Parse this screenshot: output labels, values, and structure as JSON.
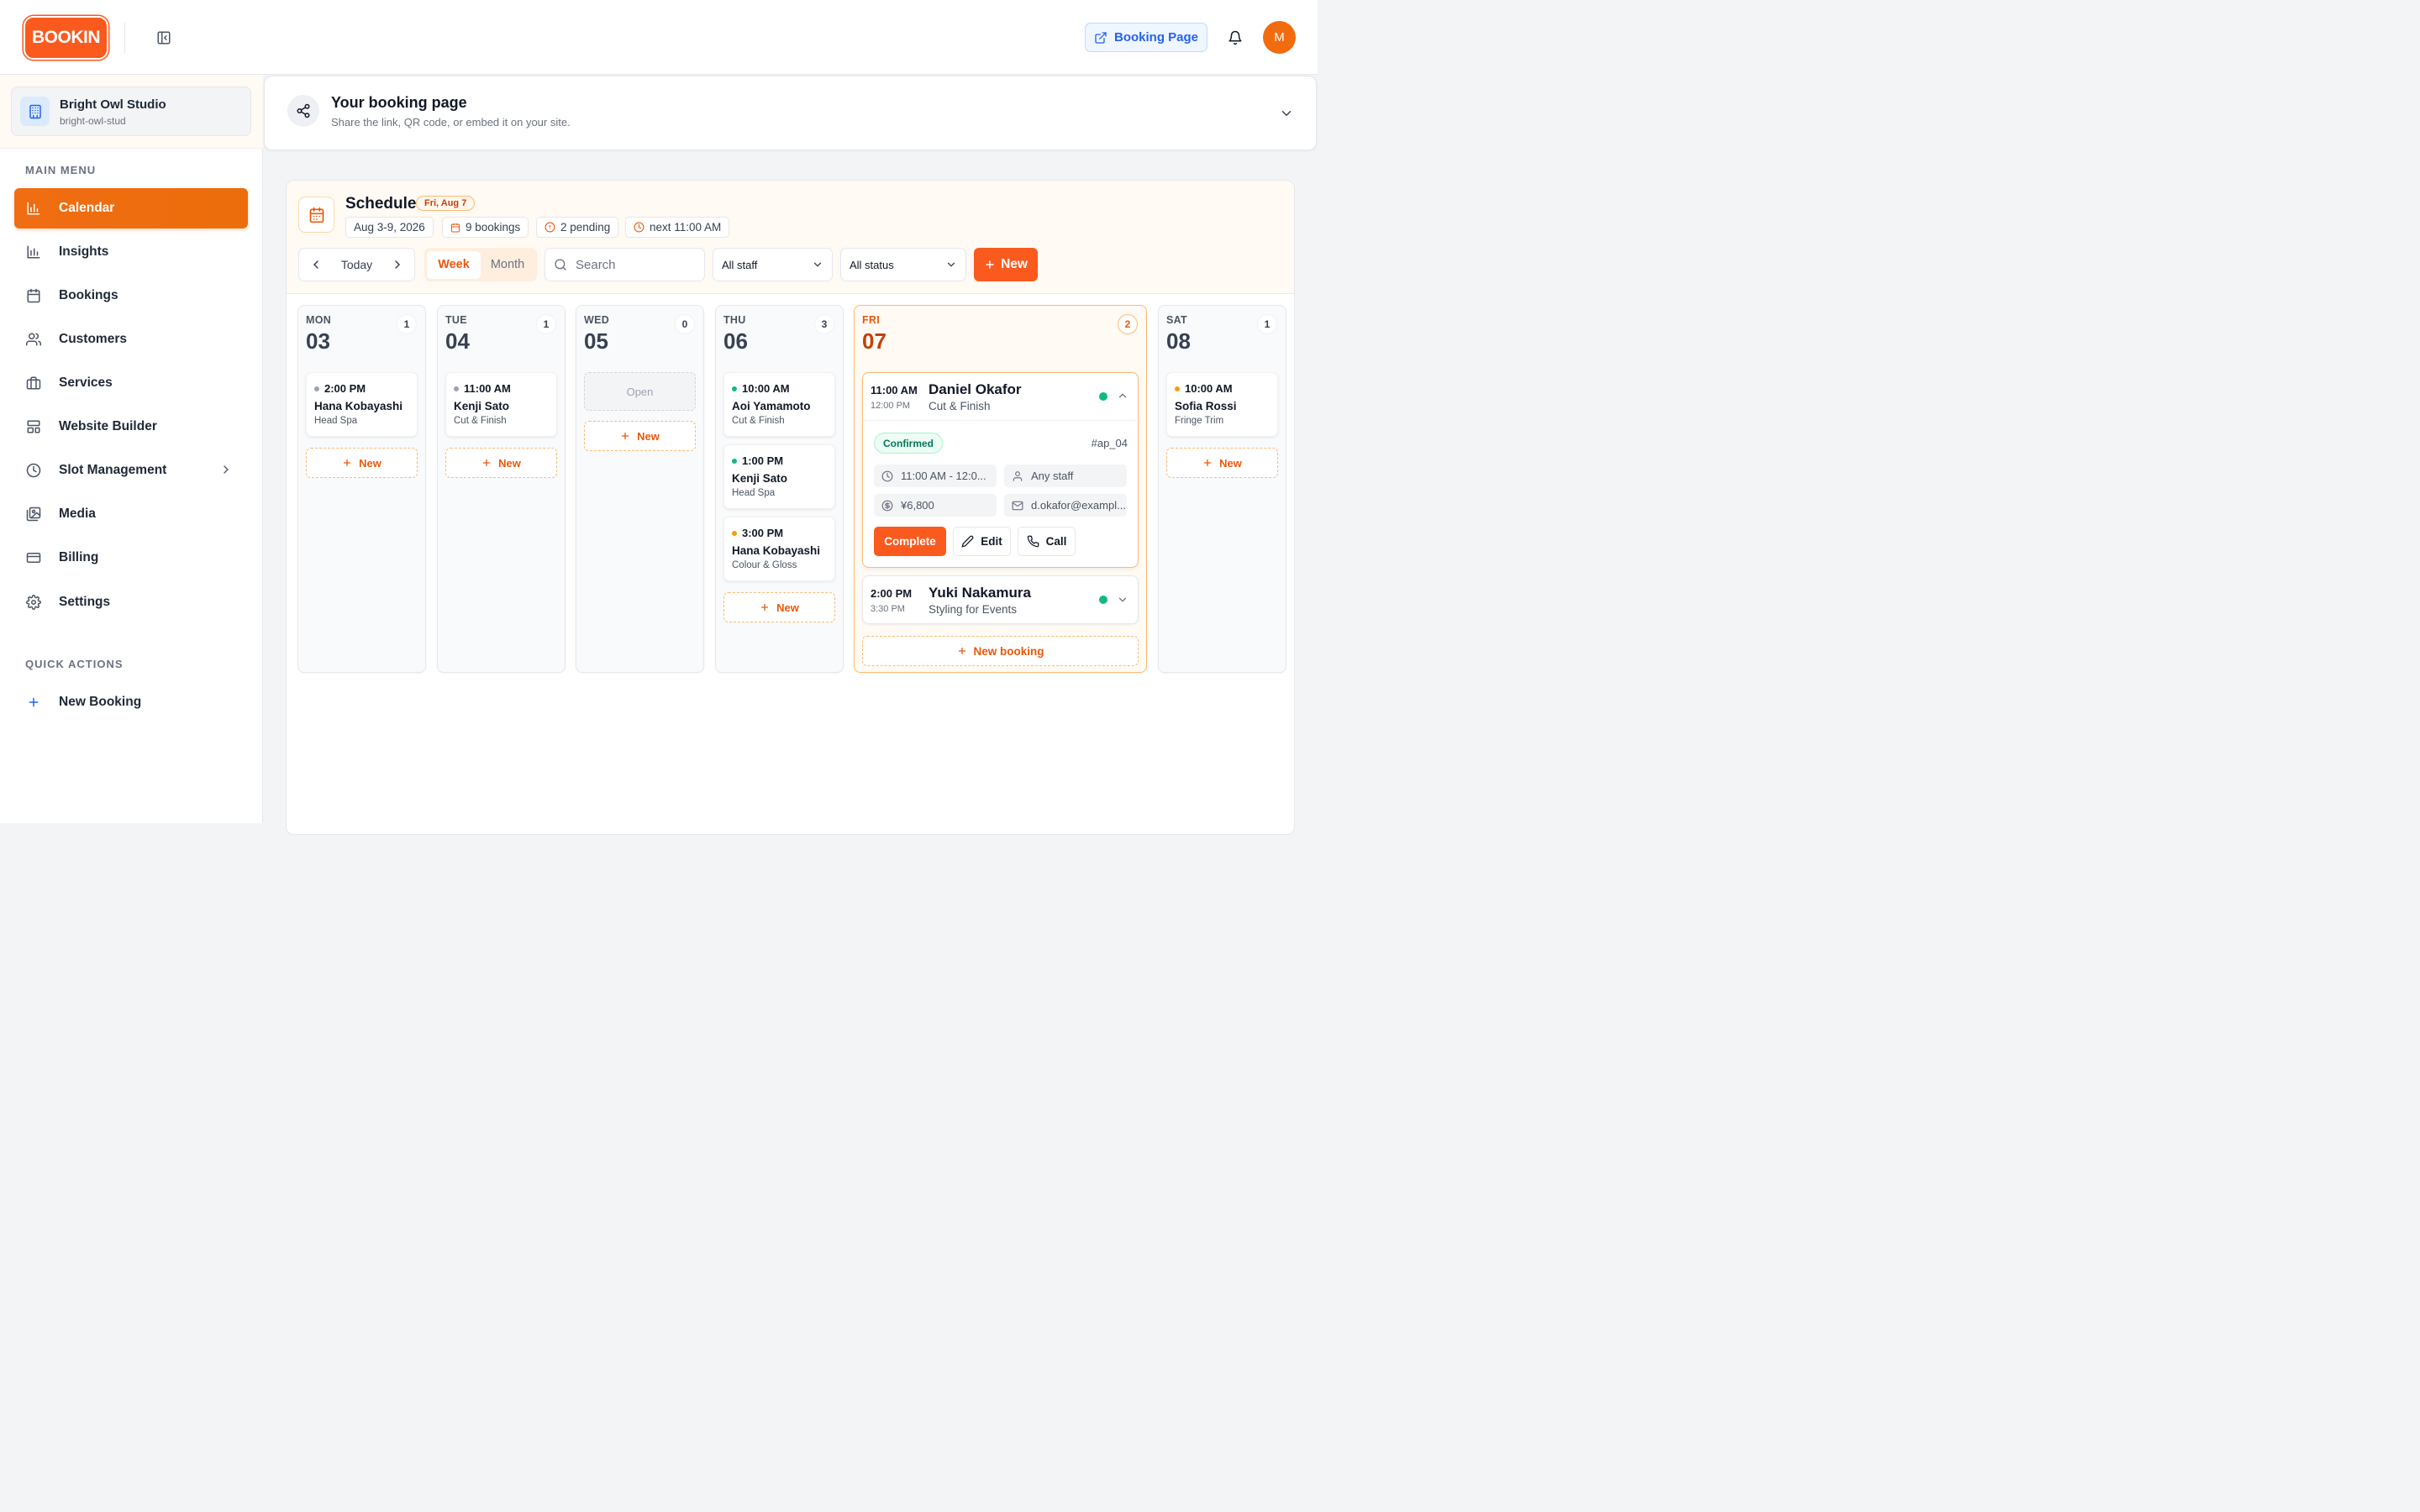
{
  "app": {
    "logo_text": "BOOKIN",
    "booking_page_label": "Booking Page",
    "avatar_initial": "M",
    "accent_color": "#fa5a1e"
  },
  "sidebar": {
    "org_name": "Bright Owl Studio",
    "org_slug": "bright-owl-stud",
    "main_menu_label": "MAIN MENU",
    "items": [
      {
        "label": "Calendar",
        "icon": "bar-chart-icon",
        "active": true
      },
      {
        "label": "Insights",
        "icon": "insights-icon"
      },
      {
        "label": "Bookings",
        "icon": "calendar-icon"
      },
      {
        "label": "Customers",
        "icon": "users-icon"
      },
      {
        "label": "Services",
        "icon": "briefcase-icon"
      },
      {
        "label": "Website Builder",
        "icon": "layout-icon"
      },
      {
        "label": "Slot Management",
        "icon": "clock-icon"
      },
      {
        "label": "Media",
        "icon": "image-icon"
      },
      {
        "label": "Billing",
        "icon": "credit-card-icon"
      },
      {
        "label": "Settings",
        "icon": "gear-icon"
      }
    ],
    "quick_actions_label": "QUICK ACTIONS",
    "quick_new_booking": "New Booking"
  },
  "share": {
    "title": "Your booking page",
    "subtitle": "Share the link, QR code, or embed it on your site."
  },
  "schedule": {
    "title": "Schedule",
    "date_pill": "Fri, Aug 7",
    "range": "Aug 3-9, 2026",
    "bookings": "9 bookings",
    "pending": "2 pending",
    "next": "next 11:00 AM",
    "today_label": "Today",
    "week_label": "Week",
    "month_label": "Month",
    "search_placeholder": "Search",
    "staff_select": "All staff",
    "status_select": "All status",
    "new_label": "New",
    "day_new_label": "New",
    "open_label": "Open"
  },
  "days": {
    "mon": {
      "dow": "MON",
      "num": "03",
      "count": "1",
      "appts": [
        {
          "time": "2:00 PM",
          "name": "Hana Kobayashi",
          "service": "Head Spa",
          "status_color": "#9ca3af"
        }
      ]
    },
    "tue": {
      "dow": "TUE",
      "num": "04",
      "count": "1",
      "appts": [
        {
          "time": "11:00 AM",
          "name": "Kenji Sato",
          "service": "Cut & Finish",
          "status_color": "#9ca3af"
        }
      ]
    },
    "wed": {
      "dow": "WED",
      "num": "05",
      "count": "0"
    },
    "thu": {
      "dow": "THU",
      "num": "06",
      "count": "3",
      "appts": [
        {
          "time": "10:00 AM",
          "name": "Aoi Yamamoto",
          "service": "Cut & Finish",
          "status_color": "#10b981"
        },
        {
          "time": "1:00 PM",
          "name": "Kenji Sato",
          "service": "Head Spa",
          "status_color": "#10b981"
        },
        {
          "time": "3:00 PM",
          "name": "Hana Kobayashi",
          "service": "Colour & Gloss",
          "status_color": "#f59e0b"
        }
      ]
    },
    "fri": {
      "dow": "FRI",
      "num": "07",
      "count": "2",
      "expanded": {
        "start": "11:00 AM",
        "end": "12:00 PM",
        "name": "Daniel Okafor",
        "service": "Cut & Finish",
        "status": "Confirmed",
        "id": "#ap_04",
        "time_range": "11:00 AM - 12:0...",
        "staff": "Any staff",
        "price": "¥6,800",
        "email": "d.okafor@exampl...",
        "complete_label": "Complete",
        "edit_label": "Edit",
        "call_label": "Call"
      },
      "second": {
        "start": "2:00 PM",
        "end": "3:30 PM",
        "name": "Yuki Nakamura",
        "service": "Styling for Events"
      },
      "new_booking_label": "New booking"
    },
    "sat": {
      "dow": "SAT",
      "num": "08",
      "count": "1",
      "appts": [
        {
          "time": "10:00 AM",
          "name": "Sofia Rossi",
          "service": "Fringe Trim",
          "status_color": "#f59e0b"
        }
      ]
    }
  }
}
